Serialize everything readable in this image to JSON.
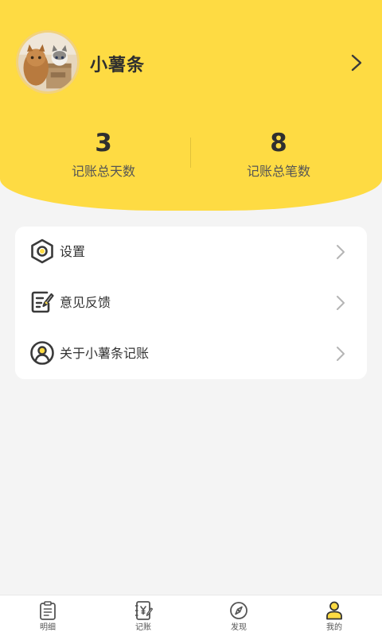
{
  "profile": {
    "username": "小薯条",
    "avatar_icon": "avatar-cats-photo",
    "arrow_icon": "chevron-right-icon"
  },
  "stats": {
    "days": {
      "value": "3",
      "label": "记账总天数"
    },
    "entries": {
      "value": "8",
      "label": "记账总笔数"
    }
  },
  "menu": {
    "items": [
      {
        "label": "设置",
        "icon": "settings-hexagon-icon"
      },
      {
        "label": "意见反馈",
        "icon": "feedback-edit-icon"
      },
      {
        "label": "关于小薯条记账",
        "icon": "user-circle-icon"
      }
    ]
  },
  "nav": {
    "items": [
      {
        "label": "明细",
        "icon": "clipboard-list-icon",
        "active": false
      },
      {
        "label": "记账",
        "icon": "ledger-yen-icon",
        "active": false
      },
      {
        "label": "发现",
        "icon": "compass-icon",
        "active": false
      },
      {
        "label": "我的",
        "icon": "person-icon",
        "active": true
      }
    ]
  },
  "colors": {
    "accent": "#fedb43",
    "background": "#f4f4f4",
    "text": "#333333"
  }
}
